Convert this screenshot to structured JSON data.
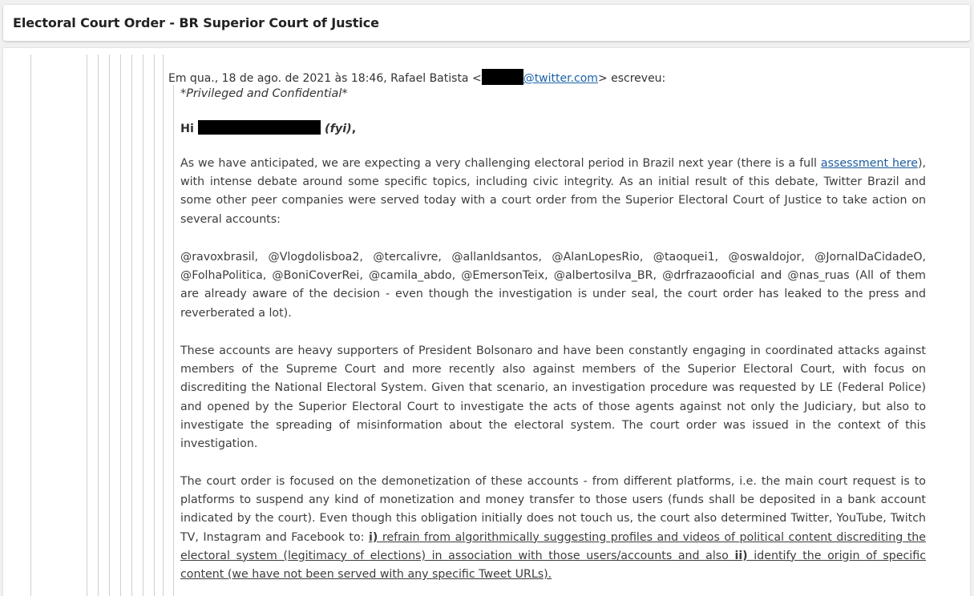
{
  "header": {
    "title": "Electoral Court Order - BR Superior Court of Justice"
  },
  "reply": {
    "prefix": "Em qua., 18 de ago. de 2021 às 18:46, Rafael Batista <",
    "email_domain": "@twitter.com",
    "suffix": "> escreveu:"
  },
  "message": {
    "privileged": "*Privileged and Confidential*",
    "greeting_hi": "Hi",
    "greeting_fyi": "(fyi)",
    "greeting_end": ",",
    "p1_a": "As we have anticipated, we are expecting a very challenging electoral period in Brazil next year (there is a full ",
    "p1_link": "assessment here",
    "p1_b": "), with intense debate around some specific topics, including civic integrity. As an initial result of this debate, Twitter Brazil and some other peer companies were served today with a court order from the Superior Electoral Court of Justice to take action on several accounts:",
    "p2": "@ravoxbrasil, @Vlogdolisboa2, @tercalivre, @allanldsantos, @AlanLopesRio, @taoquei1, @oswaldojor, @JornalDaCidadeO, @FolhaPolitica, @BoniCoverRei, @camila_abdo, @EmersonTeix, @albertosilva_BR, @drfrazaooficial and @nas_ruas (All of them are already aware of the decision - even though the investigation is under seal, the court order has leaked to the press and reverberated a lot).",
    "p3": "These accounts are heavy supporters of President Bolsonaro and have been constantly engaging in coordinated attacks against members of the Supreme Court and more recently also against members of the Superior Electoral Court, with focus on discrediting the National Electoral System. Given that scenario, an investigation procedure was requested by LE (Federal Police) and opened by the Superior Electoral Court to investigate the acts of those agents against not only the Judiciary, but also to investigate the spreading of misinformation about the electoral system. The court order was issued in the context of this investigation.",
    "p4_a": "The court order is focused on the demonetization of these accounts - from different platforms, i.e. the main court request is to platforms to suspend any kind of monetization and money transfer to those users (funds shall be deposited in a bank account indicated by the court). Even though this obligation initially does not touch us, the court also determined Twitter, YouTube, Twitch TV, Instagram and Facebook to: ",
    "p4_i1": "i)",
    "p4_b": " refrain from algorithmically suggesting profiles and videos of political content discrediting the electoral system (legitimacy of elections) in association with those users/accounts and also ",
    "p4_i2": "ii)",
    "p4_c": " identify the origin of specific content (we have not been served with any specific Tweet URLs)."
  },
  "colors": {
    "link": "#1a5c9e",
    "redaction": "#000000",
    "quote_line": "#cfcfcf"
  }
}
